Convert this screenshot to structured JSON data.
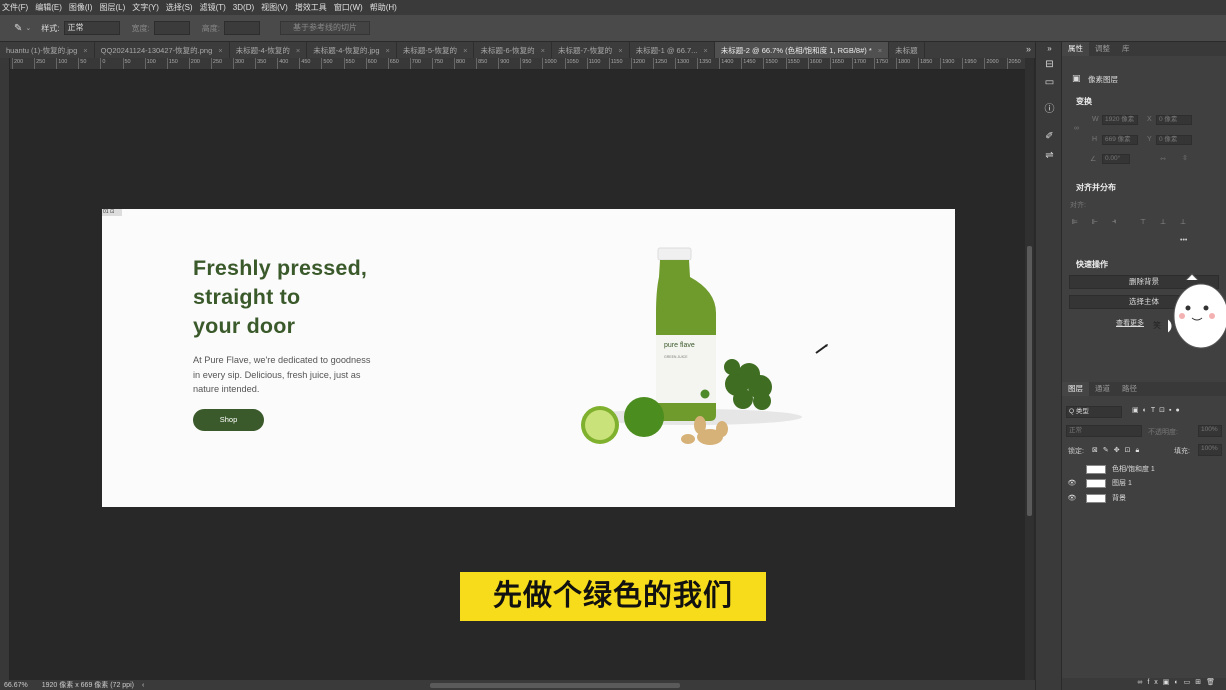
{
  "menubar": [
    "文件(F)",
    "编辑(E)",
    "图像(I)",
    "图层(L)",
    "文字(Y)",
    "选择(S)",
    "滤镜(T)",
    "3D(D)",
    "视图(V)",
    "增效工具",
    "窗口(W)",
    "帮助(H)"
  ],
  "options": {
    "style_label": "样式:",
    "style_value": "正常",
    "width_label": "宽度:",
    "height_label": "高度:",
    "slice_button": "基于参考线的切片"
  },
  "tabs": [
    {
      "label": "huantu (1)-恢复的.jpg",
      "close": "×"
    },
    {
      "label": "QQ20241124-130427-恢复的.png",
      "close": "×"
    },
    {
      "label": "未标题-4-恢复的",
      "close": "×"
    },
    {
      "label": "未标题-4-恢复的.jpg",
      "close": "×"
    },
    {
      "label": "未标题-5-恢复的",
      "close": "×"
    },
    {
      "label": "未标题-6-恢复的",
      "close": "×"
    },
    {
      "label": "未标题-7-恢复的",
      "close": "×"
    },
    {
      "label": "未标题-1 @ 66.7...",
      "close": "×"
    },
    {
      "label": "未标题-2 @ 66.7% (色相/饱和度 1, RGB/8#) *",
      "close": "×"
    },
    {
      "label": "未标题",
      "close": ""
    }
  ],
  "tabs_more": "»",
  "ruler_labels": [
    "200",
    "250",
    "100",
    "50",
    "0",
    "50",
    "100",
    "150",
    "200",
    "250",
    "300",
    "350",
    "400",
    "450",
    "500",
    "550",
    "600",
    "650",
    "700",
    "750",
    "800",
    "850",
    "900",
    "950",
    "1000",
    "1050",
    "1100",
    "1150",
    "1200",
    "1250",
    "1300",
    "1350",
    "1400",
    "1450",
    "1500",
    "1550",
    "1600",
    "1650",
    "1700",
    "1750",
    "1800",
    "1850",
    "1900",
    "1950",
    "2000",
    "2050"
  ],
  "status": {
    "zoom": "66.67%",
    "doc_size": "1920 像素 x 669 像素 (72 ppi)",
    "arrow": "‹"
  },
  "design": {
    "headline": [
      "Freshly pressed,",
      "straight to",
      "your door"
    ],
    "description": [
      "At Pure Flave, we're dedicated to goodness",
      "in every sip. Delicious, fresh juice, just as",
      "nature intended."
    ],
    "shop_button": "Shop",
    "bottle_brand": "pure flave",
    "bottle_sub": "GREEN JUICE",
    "corner_tag": "01 ⊡",
    "colors": {
      "brand_green": "#3b5a2b",
      "canvas_bg": "#fbfbfb"
    }
  },
  "subtitle": "先做个绿色的我们",
  "panel": {
    "tabs": [
      "属性",
      "调整",
      "库"
    ],
    "layer_type": "像素图层",
    "transform_title": "变换",
    "w_label": "W",
    "w_value": "1920 像素",
    "x_label": "X",
    "x_value": "0 像素",
    "h_label": "H",
    "h_value": "669 像素",
    "y_label": "Y",
    "y_value": "0 像素",
    "angle_value": "0.00°",
    "align_title": "对齐并分布",
    "align_label": "对齐:",
    "quick_title": "快速操作",
    "remove_bg": "删除背景",
    "select_subject": "选择主体",
    "view_more": "查看更多",
    "sticker_text": "笑"
  },
  "layers": {
    "tabs": [
      "图层",
      "通道",
      "路径"
    ],
    "filter": "Q 类型",
    "blend": "正常",
    "opacity_label": "不透明度:",
    "opacity_value": "100%",
    "lock_label": "锁定:",
    "fill_label": "填充:",
    "fill_value": "100%",
    "items": [
      {
        "name": "色相/饱和度 1",
        "visible": false
      },
      {
        "name": "图层 1",
        "visible": true
      },
      {
        "name": "背景",
        "visible": true
      }
    ]
  }
}
